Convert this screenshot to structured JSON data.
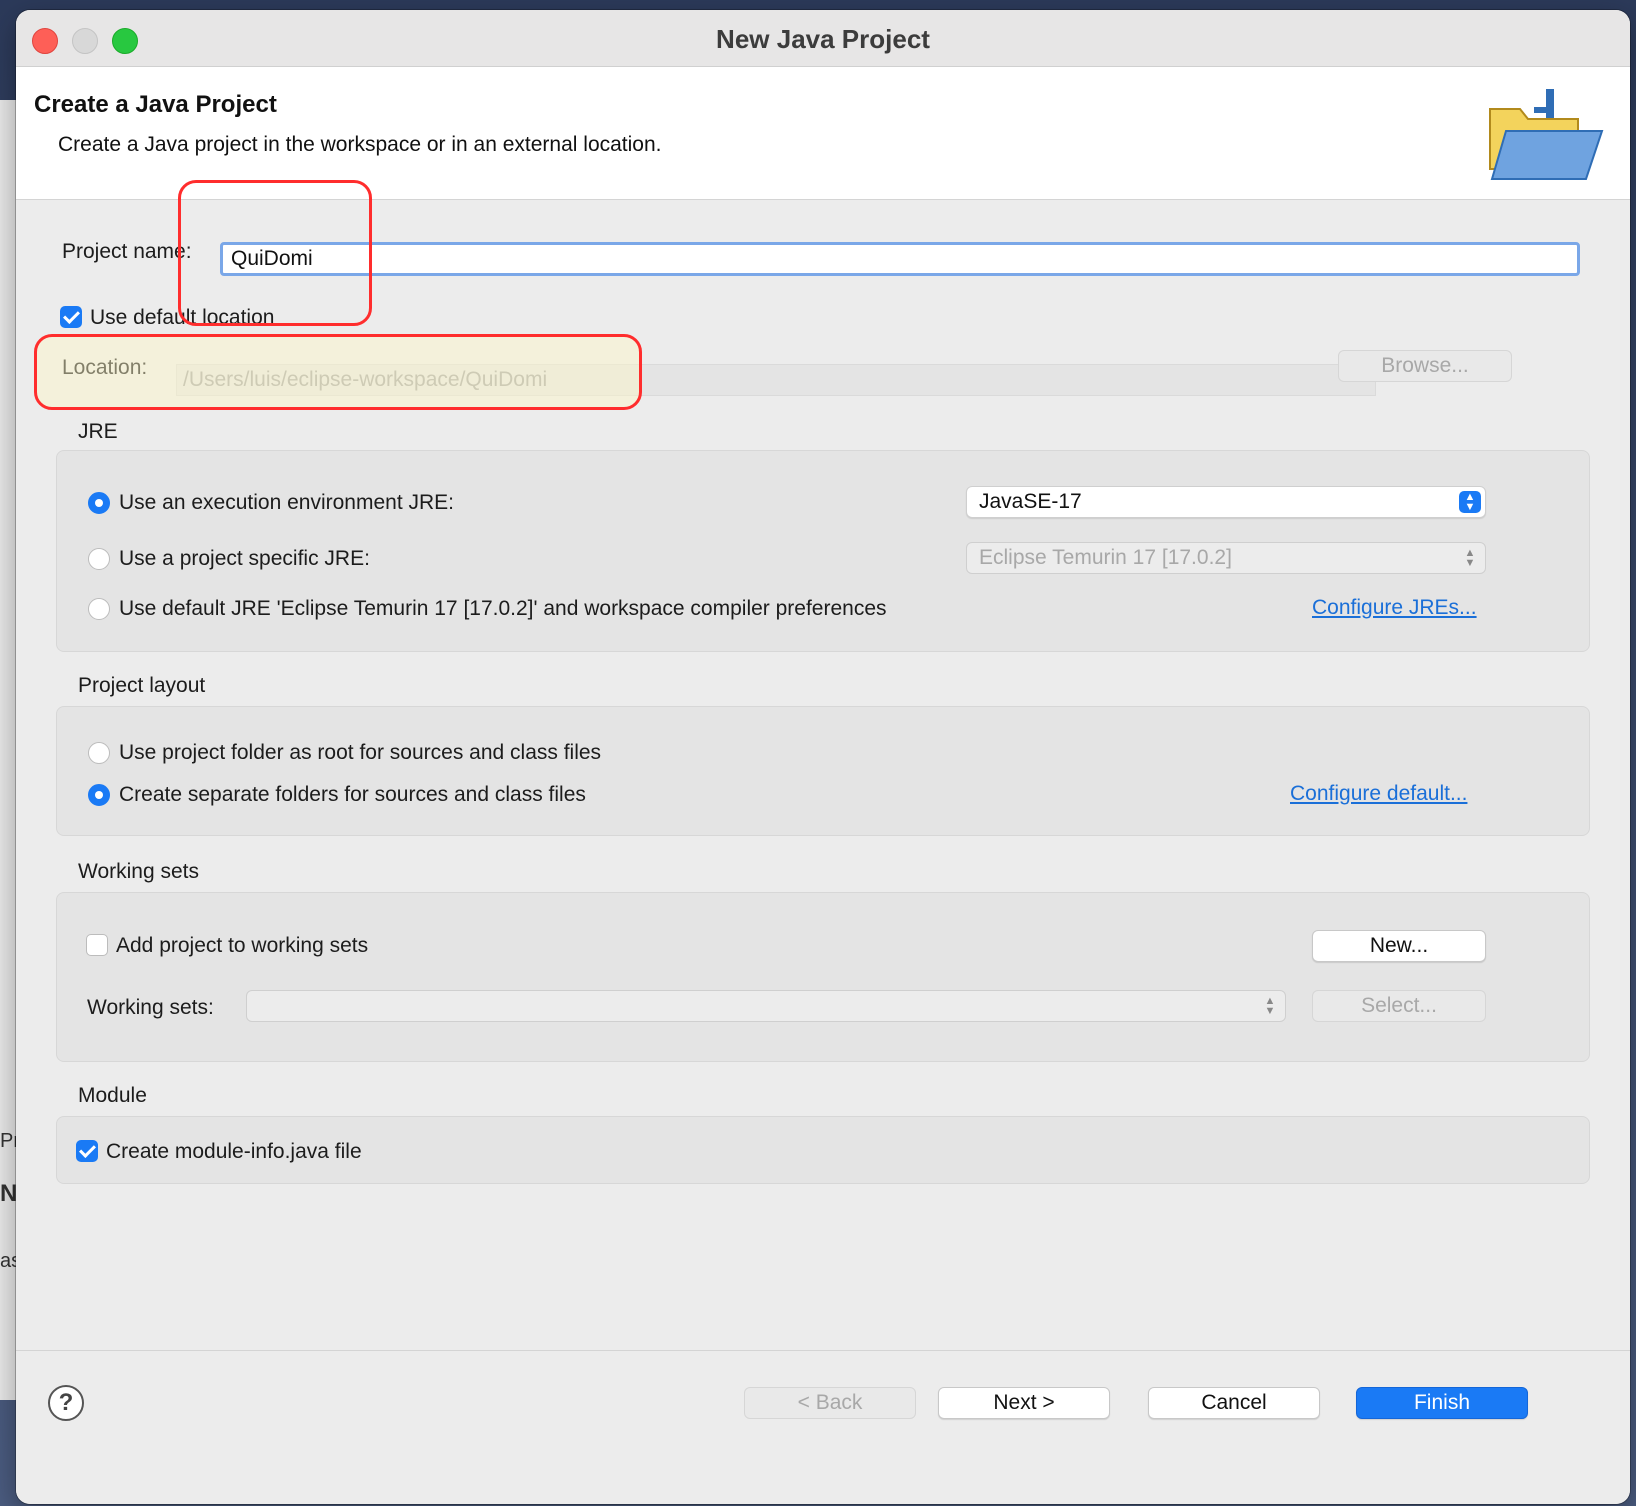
{
  "window": {
    "title": "New Java Project"
  },
  "header": {
    "title": "Create a Java Project",
    "description": "Create a Java project in the workspace or in an external location.",
    "icon": "folder-icon"
  },
  "project_name": {
    "label": "Project name:",
    "value": "QuiDomi"
  },
  "use_default_location": {
    "label": "Use default location",
    "checked": true
  },
  "location": {
    "label": "Location:",
    "value": "/Users/luis/eclipse-workspace/QuiDomi",
    "browse_label": "Browse..."
  },
  "jre": {
    "title": "JRE",
    "option_env": "Use an execution environment JRE:",
    "env_value": "JavaSE-17",
    "option_specific": "Use a project specific JRE:",
    "specific_value": "Eclipse Temurin 17 [17.0.2]",
    "option_default": "Use default JRE 'Eclipse Temurin 17 [17.0.2]' and workspace compiler preferences",
    "configure_link": "Configure JREs..."
  },
  "layout": {
    "title": "Project layout",
    "option_root": "Use project folder as root for sources and class files",
    "option_separate": "Create separate folders for sources and class files",
    "configure_link": "Configure default..."
  },
  "working_sets": {
    "title": "Working sets",
    "add_label": "Add project to working sets",
    "new_button": "New...",
    "sets_label": "Working sets:",
    "select_button": "Select..."
  },
  "module": {
    "title": "Module",
    "create_label": "Create module-info.java file"
  },
  "footer": {
    "help": "?",
    "back": "< Back",
    "next": "Next >",
    "cancel": "Cancel",
    "finish": "Finish"
  },
  "behind_window": {
    "text1": "Pr",
    "text2": "N",
    "text3": "as"
  },
  "colors": {
    "accent": "#1a7af5",
    "annotation": "#ff2d2d",
    "link": "#1a6fd8"
  }
}
